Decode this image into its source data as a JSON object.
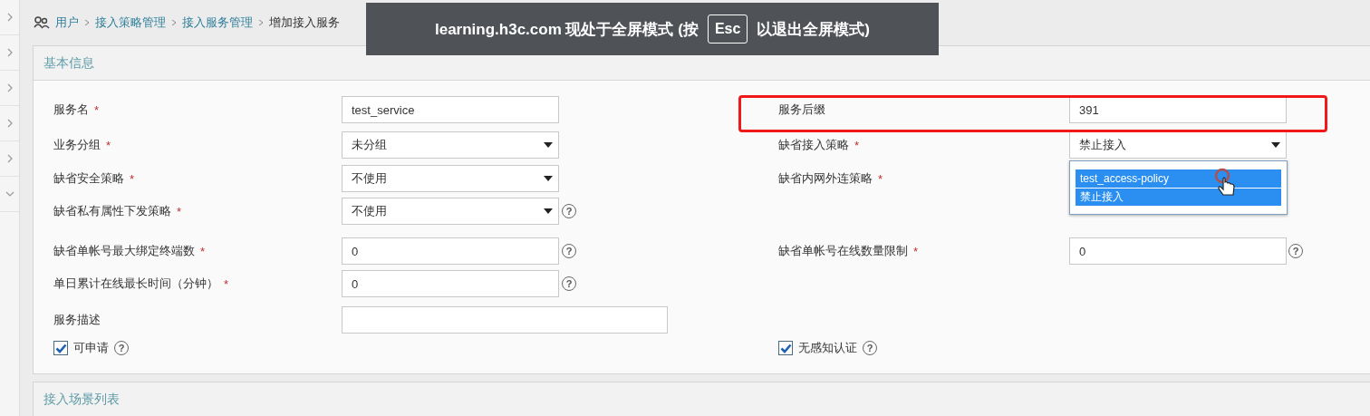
{
  "sidebar": {
    "items": [
      {
        "expanded": false
      },
      {
        "expanded": false
      },
      {
        "expanded": false
      },
      {
        "expanded": false
      },
      {
        "expanded": false
      },
      {
        "expanded": true
      }
    ]
  },
  "breadcrumb": [
    {
      "label": "用户",
      "link": true
    },
    {
      "label": "接入策略管理",
      "link": true
    },
    {
      "label": "接入服务管理",
      "link": true
    },
    {
      "label": "增加接入服务",
      "link": false
    }
  ],
  "fullscreen_notice": {
    "text_before": "learning.h3c.com 现处于全屏模式 (按",
    "key": "Esc",
    "text_after": "以退出全屏模式)"
  },
  "basic_info": {
    "title": "基本信息",
    "rows": [
      {
        "left": {
          "label": "服务名",
          "required_mark": "*",
          "kind": "text",
          "value": "test_service"
        },
        "right": {
          "label": "服务后缀",
          "kind": "text",
          "value": "391",
          "highlighted": true
        }
      },
      {
        "left": {
          "label": "业务分组",
          "required_mark": "*",
          "kind": "select",
          "value": "未分组"
        },
        "right": {
          "label": "缺省接入策略",
          "required_mark": "*",
          "kind": "select",
          "value": "禁止接入",
          "expanded": true,
          "options": [
            {
              "label": "test_access-policy",
              "selected": true
            },
            {
              "label": "禁止接入",
              "selected": true
            }
          ]
        }
      },
      {
        "left": {
          "label": "缺省安全策略",
          "required_mark": "*",
          "kind": "select",
          "value": "不使用"
        },
        "right": {
          "label": "缺省内网外连策略",
          "required_mark": "*"
        }
      },
      {
        "left": {
          "label": "缺省私有属性下发策略",
          "required_mark": "*",
          "kind": "select",
          "value": "不使用",
          "help": "?"
        }
      },
      {
        "left": {
          "label": "缺省单帐号最大绑定终端数",
          "required_mark": "*",
          "kind": "text",
          "value": "0",
          "help": "?"
        },
        "right": {
          "label": "缺省单帐号在线数量限制",
          "required_mark": "*",
          "kind": "text",
          "value": "0",
          "help": "?"
        }
      },
      {
        "left": {
          "label": "单日累计在线最长时间（分钟）",
          "required_mark": "*",
          "kind": "text",
          "value": "0",
          "help": "?"
        }
      },
      {
        "left": {
          "label": "服务描述",
          "kind": "textarea"
        }
      },
      {
        "left": {
          "label": "可申请",
          "kind": "checkbox",
          "checked": true,
          "help": "?"
        },
        "right": {
          "label": "无感知认证",
          "kind": "checkbox",
          "checked": true,
          "help": "?"
        }
      }
    ]
  },
  "scene_list": {
    "title": "接入场景列表"
  }
}
